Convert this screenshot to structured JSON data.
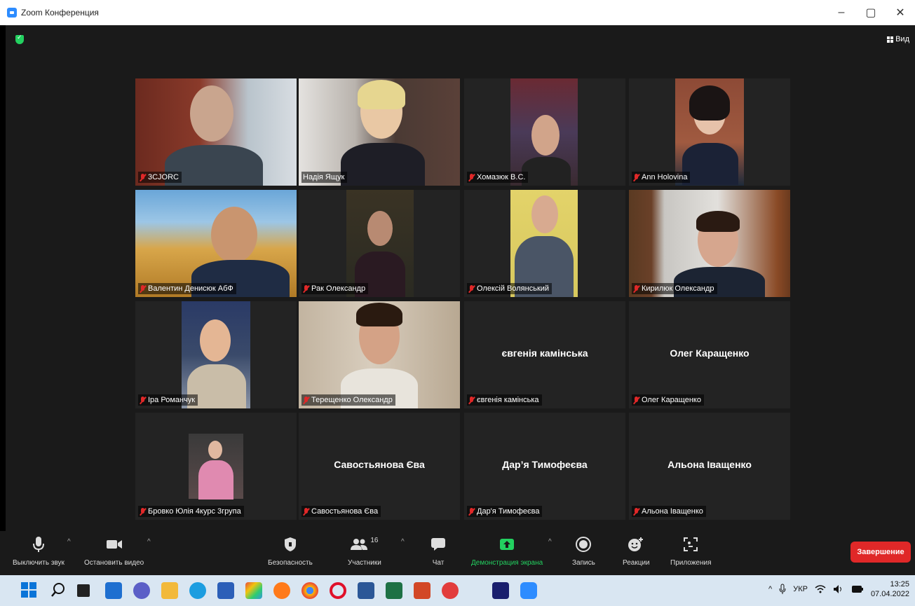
{
  "window": {
    "title": "Zoom Конференция",
    "minimize": "–",
    "restore": "▢",
    "close": "✕"
  },
  "header": {
    "view_label": "Вид"
  },
  "participants": [
    {
      "name": "3CJORC",
      "video": true
    },
    {
      "name": "Надія Ящук",
      "video": true
    },
    {
      "name": "Хомазюк В.С.",
      "video": true
    },
    {
      "name": "Ann Holovina",
      "video": true
    },
    {
      "name": "Валентин Денисюк АбФ",
      "video": true
    },
    {
      "name": "Рак Олександр",
      "video": true
    },
    {
      "name": "Олексій Волянський",
      "video": true
    },
    {
      "name": "Кирилюк Олександр",
      "video": true
    },
    {
      "name": "Іра Романчук",
      "video": true
    },
    {
      "name": "Терещенко Олександр",
      "video": true
    },
    {
      "name": "євгенія камінська",
      "video": false,
      "display_name": "євгенія камінська"
    },
    {
      "name": "Олег Каращенко",
      "video": false,
      "display_name": "Олег Каращенко"
    },
    {
      "name": "Бровко Юлія 4курс 3група",
      "video": true
    },
    {
      "name": "Савостьянова Єва",
      "video": false,
      "display_name": "Савостьянова Єва"
    },
    {
      "name": "Дар'я Тимофеєва",
      "video": false,
      "display_name": "Дар’я Тимофеєва"
    },
    {
      "name": "Альона Іващенко",
      "video": false,
      "display_name": "Альона Іващенко"
    }
  ],
  "toolbar": {
    "mute": "Выключить звук",
    "stop_video": "Остановить видео",
    "security": "Безопасность",
    "participants": "Участники",
    "participants_count": "16",
    "chat": "Чат",
    "share_screen": "Демонстрация экрана",
    "record": "Запись",
    "reactions": "Реакции",
    "apps": "Приложения",
    "end": "Завершение"
  },
  "taskbar": {
    "language": "УКР",
    "time": "13:25",
    "date": "07.04.2022",
    "tray_up": "^"
  },
  "colors": {
    "accent_green": "#23d160",
    "end_red": "#e02828",
    "active_speaker": "#c7e26d"
  }
}
